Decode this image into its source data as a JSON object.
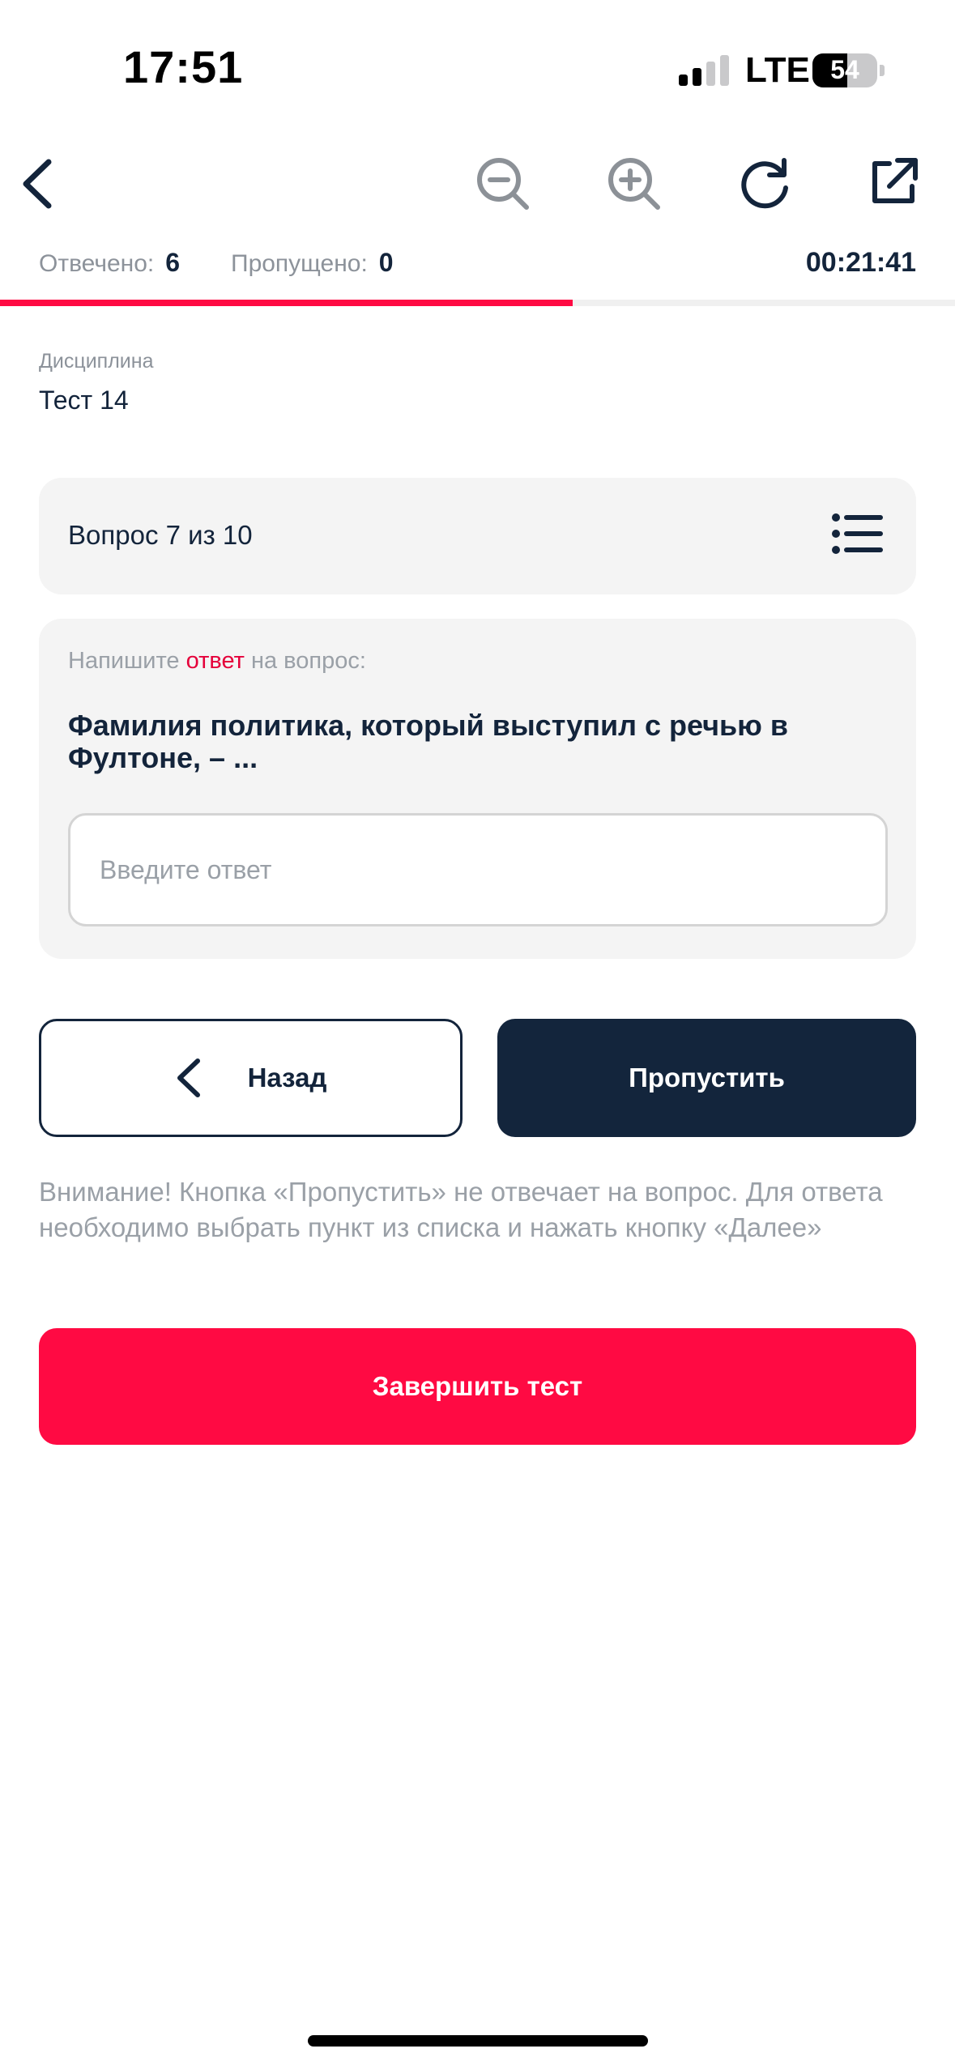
{
  "status_bar": {
    "time": "17:51",
    "network": "LTE",
    "battery": "54",
    "battery_level_percent": 54,
    "signal_bars_active": 2,
    "signal_bars_total": 4
  },
  "toolbar": {
    "back_icon": "chevron-left-icon",
    "zoom_out_icon": "zoom-out-icon",
    "zoom_in_icon": "zoom-in-icon",
    "refresh_icon": "refresh-icon",
    "open_external_icon": "open-external-icon"
  },
  "counters": {
    "answered_label": "Отвечено:",
    "answered_value": "6",
    "skipped_label": "Пропущено:",
    "skipped_value": "0",
    "timer": "00:21:41"
  },
  "progress": {
    "answered": 6,
    "total": 10
  },
  "discipline": {
    "label": "Дисциплина",
    "value": "Тест 14"
  },
  "question_header": {
    "text": "Вопрос 7 из 10",
    "list_icon": "list-icon"
  },
  "question": {
    "instruction_before": "Напишите ",
    "instruction_accent": "ответ",
    "instruction_after": " на вопрос:",
    "text": "Фамилия политика, который выступил с речью в Фултоне, – ...",
    "input_placeholder": "Введите ответ",
    "input_value": ""
  },
  "buttons": {
    "back_label": "Назад",
    "skip_label": "Пропустить",
    "finish_label": "Завершить тест"
  },
  "warning": "Внимание! Кнопка «Пропустить» не отвечает на вопрос. Для ответа необходимо выбрать пункт из списка и нажать кнопку «Далее»",
  "colors": {
    "accent": "#ff0a43",
    "primary_dark": "#13253c",
    "card_bg": "#f4f4f4",
    "muted_text": "#9aa0a7"
  }
}
